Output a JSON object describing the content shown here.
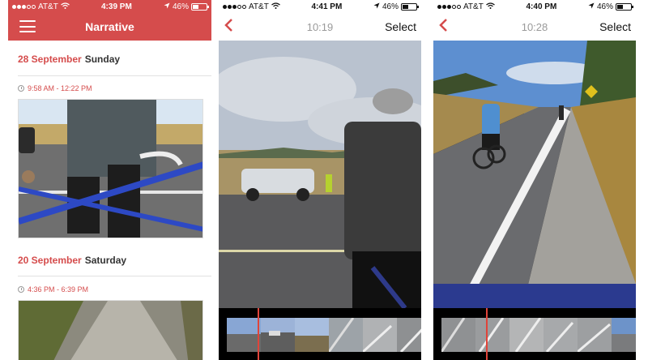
{
  "screens": [
    {
      "status": {
        "carrier": "AT&T",
        "time": "4:39 PM",
        "battery": "46%",
        "battery_level": 0.46
      },
      "header": {
        "title": "Narrative",
        "menu_icon": "hamburger-icon"
      },
      "days": [
        {
          "date": "28 September",
          "weekday": "Sunday",
          "time_range": "9:58 AM - 12:22 PM"
        },
        {
          "date": "20 September",
          "weekday": "Saturday",
          "time_range": "4:36 PM - 6:39 PM"
        }
      ]
    },
    {
      "status": {
        "carrier": "AT&T",
        "time": "4:41 PM",
        "battery": "46%",
        "battery_level": 0.46
      },
      "nav": {
        "back_icon": "chevron-left-icon",
        "duration": "10:19",
        "select_label": "Select"
      },
      "scrubber": {
        "playhead_position": 0.19,
        "frame_count": 6
      }
    },
    {
      "status": {
        "carrier": "AT&T",
        "time": "4:40 PM",
        "battery": "46%",
        "battery_level": 0.46
      },
      "nav": {
        "back_icon": "chevron-left-icon",
        "duration": "10:28",
        "select_label": "Select"
      },
      "scrubber": {
        "playhead_position": 0.26,
        "frame_count": 6
      }
    }
  ],
  "colors": {
    "accent": "#d54c4c",
    "playhead": "#e0443a"
  }
}
